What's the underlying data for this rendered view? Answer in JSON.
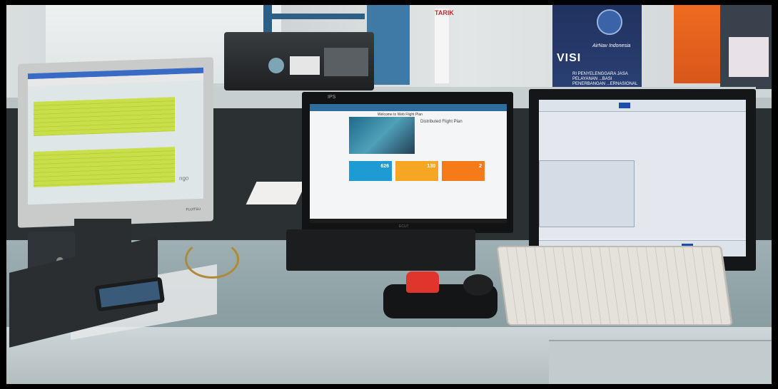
{
  "scene": {
    "poster": {
      "logo_text": "AirNav",
      "org": "AirNav Indonesia",
      "headline": "VISI",
      "subline": "RI PENYELENGGARA JASA PELAYANAN ...BASI PENERBANGAN ...ERNASIONAL"
    },
    "window_label": "TARIK",
    "monitor_left": {
      "brand": "FUJITSU",
      "logo": "ngo"
    },
    "monitor_center": {
      "tag": "IPS",
      "welcome": "Welcome to Web Flight Plan",
      "feature_title": "Distributed Flight Plan",
      "tiles": [
        {
          "value": "626",
          "label": "",
          "color": "#1e9bd3"
        },
        {
          "value": "130",
          "label": "",
          "color": "#f5a623"
        },
        {
          "value": "2",
          "label": "",
          "color": "#f57a1a"
        }
      ],
      "brand": "ECUT"
    },
    "monitor_right": {
      "selected_button": "PBL"
    }
  }
}
